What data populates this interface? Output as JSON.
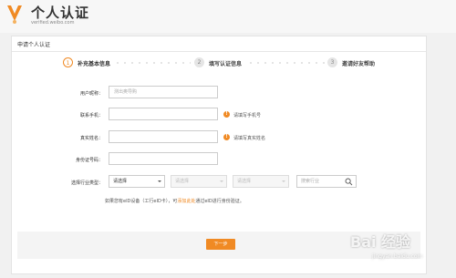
{
  "header": {
    "title": "个人认证",
    "subtitle": "verified.weibo.com"
  },
  "panel": {
    "title": "申请个人认证"
  },
  "steps": [
    {
      "num": "1",
      "label": "补充基本信息",
      "active": true
    },
    {
      "num": "2",
      "label": "填写认证信息",
      "active": false
    },
    {
      "num": "3",
      "label": "邀请好友帮助",
      "active": false
    }
  ],
  "form": {
    "nickname": {
      "label": "用户昵称：",
      "value": "测出奥导购"
    },
    "phone": {
      "label": "联系手机：",
      "value": "",
      "hint": "请填写手机号"
    },
    "realname": {
      "label": "真实姓名：",
      "value": "",
      "hint": "请填写真实姓名"
    },
    "idcard": {
      "label": "身份证号码：",
      "value": ""
    },
    "industry": {
      "label": "选择行业类型：",
      "select1": "请选择",
      "select2": "请选择",
      "select3": "请选择",
      "search_placeholder": "搜索行业"
    }
  },
  "note": {
    "prefix": "如果您有eID设备（工行eID卡），可",
    "link": "添加此处",
    "suffix": "通过eID进行身份验证。"
  },
  "next_button": "下一步",
  "watermark": {
    "text": "Bai 经验",
    "sub": "jingyan.baidu.com"
  },
  "colors": {
    "accent": "#f08a24"
  }
}
